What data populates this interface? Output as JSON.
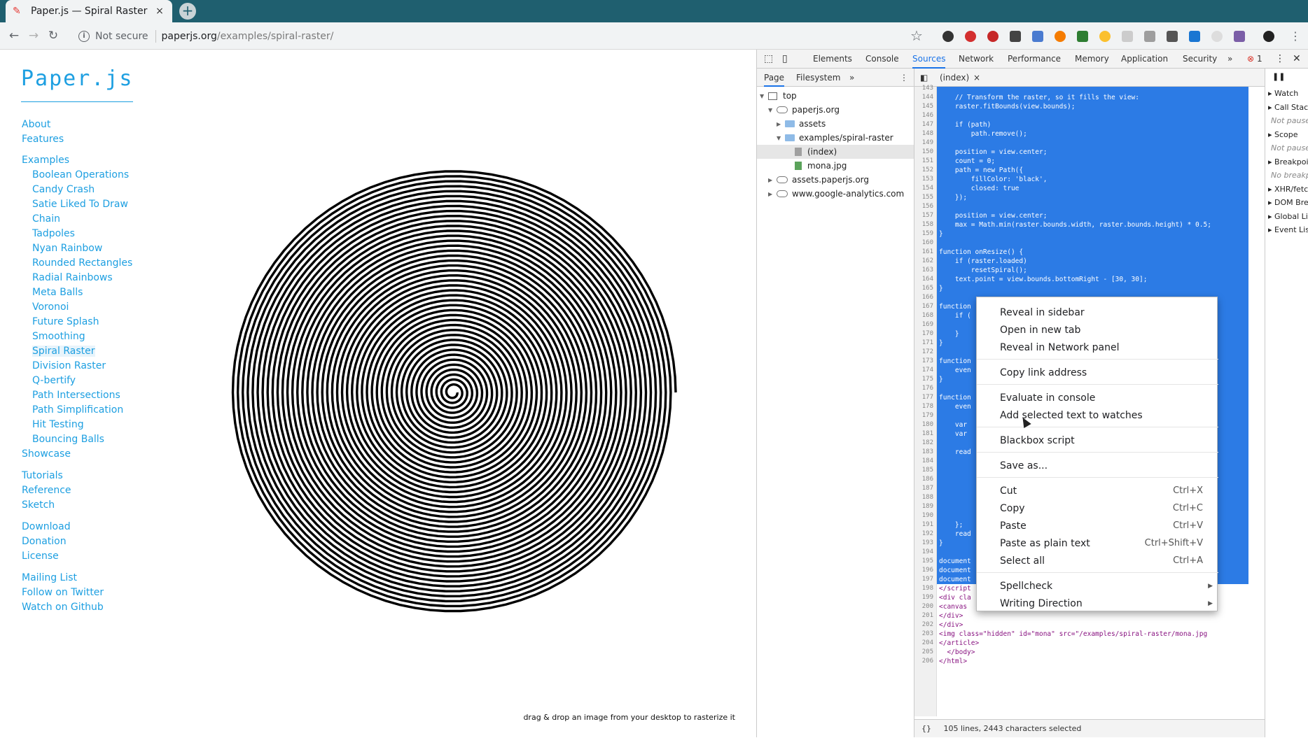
{
  "browser": {
    "tab_title": "Paper.js — Spiral Raster",
    "tab_close": "×",
    "new_tab": "+",
    "not_secure": "Not secure",
    "url_host": "paperjs.org",
    "url_path": "/examples/spiral-raster/"
  },
  "site": {
    "logo": "Paper.js",
    "nav_group1": [
      "About",
      "Features"
    ],
    "examples_label": "Examples",
    "examples": [
      "Boolean Operations",
      "Candy Crash",
      "Satie Liked To Draw",
      "Chain",
      "Tadpoles",
      "Nyan Rainbow",
      "Rounded Rectangles",
      "Radial Rainbows",
      "Meta Balls",
      "Voronoi",
      "Future Splash",
      "Smoothing",
      "Spiral Raster",
      "Division Raster",
      "Q-bertify",
      "Path Intersections",
      "Path Simplification",
      "Hit Testing",
      "Bouncing Balls"
    ],
    "showcase": "Showcase",
    "nav_group2": [
      "Tutorials",
      "Reference",
      "Sketch"
    ],
    "nav_group3": [
      "Download",
      "Donation",
      "License"
    ],
    "nav_group4": [
      "Mailing List",
      "Follow on Twitter",
      "Watch on Github"
    ],
    "hint": "drag & drop an image from your desktop to rasterize it",
    "accent_color": "#1d9fe1"
  },
  "devtools": {
    "tabs": [
      "Elements",
      "Console",
      "Sources",
      "Network",
      "Performance",
      "Memory",
      "Application",
      "Security"
    ],
    "active_tab": "Sources",
    "more": "»",
    "error_count": "1",
    "nav_tabs": [
      "Page",
      "Filesystem"
    ],
    "tree": {
      "top": "top",
      "paperjs": "paperjs.org",
      "assets": "assets",
      "examples": "examples/spiral-raster",
      "index": "(index)",
      "mona": "mona.jpg",
      "assets_host": "assets.paperjs.org",
      "ga": "www.google-analytics.com"
    },
    "editor_tab": "(index)",
    "status": "105 lines, 2443 characters selected",
    "status_icon": "{}",
    "right_sections": [
      "Watch",
      "Call Stack",
      "Not paused",
      "Scope",
      "Not paused",
      "Breakpoints",
      "No breakpoints",
      "XHR/fetch Breakpoints",
      "DOM Breakpoints",
      "Global Listeners",
      "Event Listeners"
    ],
    "code_lines": [
      {
        "n": "143",
        "t": ""
      },
      {
        "n": "144",
        "t": "    // Transform the raster, so it fills the view:"
      },
      {
        "n": "145",
        "t": "    raster.fitBounds(view.bounds);"
      },
      {
        "n": "146",
        "t": ""
      },
      {
        "n": "147",
        "t": "    if (path)"
      },
      {
        "n": "148",
        "t": "        path.remove();"
      },
      {
        "n": "149",
        "t": ""
      },
      {
        "n": "150",
        "t": "    position = view.center;"
      },
      {
        "n": "151",
        "t": "    count = 0;"
      },
      {
        "n": "152",
        "t": "    path = new Path({"
      },
      {
        "n": "153",
        "t": "        fillColor: 'black',"
      },
      {
        "n": "154",
        "t": "        closed: true"
      },
      {
        "n": "155",
        "t": "    });"
      },
      {
        "n": "156",
        "t": ""
      },
      {
        "n": "157",
        "t": "    position = view.center;"
      },
      {
        "n": "158",
        "t": "    max = Math.min(raster.bounds.width, raster.bounds.height) * 0.5;"
      },
      {
        "n": "159",
        "t": "}"
      },
      {
        "n": "160",
        "t": ""
      },
      {
        "n": "161",
        "t": "function onResize() {"
      },
      {
        "n": "162",
        "t": "    if (raster.loaded)"
      },
      {
        "n": "163",
        "t": "        resetSpiral();"
      },
      {
        "n": "164",
        "t": "    text.point = view.bounds.bottomRight - [30, 30];"
      },
      {
        "n": "165",
        "t": "}"
      },
      {
        "n": "166",
        "t": ""
      },
      {
        "n": "167",
        "t": "function"
      },
      {
        "n": "168",
        "t": "    if ("
      },
      {
        "n": "169",
        "t": ""
      },
      {
        "n": "170",
        "t": "    }"
      },
      {
        "n": "171",
        "t": "}"
      },
      {
        "n": "172",
        "t": ""
      },
      {
        "n": "173",
        "t": "function"
      },
      {
        "n": "174",
        "t": "    even"
      },
      {
        "n": "175",
        "t": "}"
      },
      {
        "n": "176",
        "t": ""
      },
      {
        "n": "177",
        "t": "function"
      },
      {
        "n": "178",
        "t": "    even"
      },
      {
        "n": "179",
        "t": ""
      },
      {
        "n": "180",
        "t": "    var"
      },
      {
        "n": "181",
        "t": "    var"
      },
      {
        "n": "182",
        "t": ""
      },
      {
        "n": "183",
        "t": "    read"
      },
      {
        "n": "184",
        "t": ""
      },
      {
        "n": "185",
        "t": ""
      },
      {
        "n": "186",
        "t": ""
      },
      {
        "n": "187",
        "t": ""
      },
      {
        "n": "188",
        "t": ""
      },
      {
        "n": "189",
        "t": ""
      },
      {
        "n": "190",
        "t": ""
      },
      {
        "n": "191",
        "t": "    };"
      },
      {
        "n": "192",
        "t": "    read"
      },
      {
        "n": "193",
        "t": "}"
      },
      {
        "n": "194",
        "t": ""
      },
      {
        "n": "195",
        "t": "document"
      },
      {
        "n": "196",
        "t": "document"
      },
      {
        "n": "197",
        "t": "document"
      },
      {
        "n": "198",
        "t": "</script"
      },
      {
        "n": "199",
        "t": "<div cla"
      },
      {
        "n": "200",
        "t": "<canvas"
      },
      {
        "n": "201",
        "t": "</div>"
      },
      {
        "n": "202",
        "t": "</div>"
      },
      {
        "n": "203",
        "t": "<img class=\"hidden\" id=\"mona\" src=\"/examples/spiral-raster/mona.jpg"
      },
      {
        "n": "204",
        "t": "</article>"
      },
      {
        "n": "205",
        "t": "  </body>"
      },
      {
        "n": "206",
        "t": "</html>"
      }
    ],
    "selection_color": "#2c7be5"
  },
  "context_menu": {
    "items": [
      {
        "label": "Reveal in sidebar",
        "shortcut": ""
      },
      {
        "label": "Open in new tab",
        "shortcut": ""
      },
      {
        "label": "Reveal in Network panel",
        "shortcut": ""
      },
      {
        "label": "Copy link address",
        "shortcut": ""
      },
      {
        "label": "Evaluate in console",
        "shortcut": ""
      },
      {
        "label": "Add selected text to watches",
        "shortcut": ""
      },
      {
        "label": "Blackbox script",
        "shortcut": ""
      },
      {
        "label": "Save as...",
        "shortcut": ""
      },
      {
        "label": "Cut",
        "shortcut": "Ctrl+X"
      },
      {
        "label": "Copy",
        "shortcut": "Ctrl+C"
      },
      {
        "label": "Paste",
        "shortcut": "Ctrl+V"
      },
      {
        "label": "Paste as plain text",
        "shortcut": "Ctrl+Shift+V"
      },
      {
        "label": "Select all",
        "shortcut": "Ctrl+A"
      },
      {
        "label": "Spellcheck",
        "shortcut": ""
      },
      {
        "label": "Writing Direction",
        "shortcut": ""
      }
    ]
  }
}
